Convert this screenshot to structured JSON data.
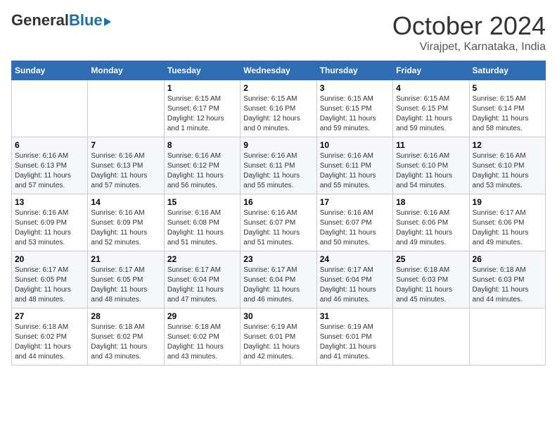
{
  "logo": {
    "general": "General",
    "blue": "Blue"
  },
  "title": "October 2024",
  "location": "Virajpet, Karnataka, India",
  "days_of_week": [
    "Sunday",
    "Monday",
    "Tuesday",
    "Wednesday",
    "Thursday",
    "Friday",
    "Saturday"
  ],
  "weeks": [
    [
      {
        "day": "",
        "info": ""
      },
      {
        "day": "",
        "info": ""
      },
      {
        "day": "1",
        "info": "Sunrise: 6:15 AM\nSunset: 6:17 PM\nDaylight: 12 hours\nand 1 minute."
      },
      {
        "day": "2",
        "info": "Sunrise: 6:15 AM\nSunset: 6:16 PM\nDaylight: 12 hours\nand 0 minutes."
      },
      {
        "day": "3",
        "info": "Sunrise: 6:15 AM\nSunset: 6:15 PM\nDaylight: 11 hours\nand 59 minutes."
      },
      {
        "day": "4",
        "info": "Sunrise: 6:15 AM\nSunset: 6:15 PM\nDaylight: 11 hours\nand 59 minutes."
      },
      {
        "day": "5",
        "info": "Sunrise: 6:15 AM\nSunset: 6:14 PM\nDaylight: 11 hours\nand 58 minutes."
      }
    ],
    [
      {
        "day": "6",
        "info": "Sunrise: 6:16 AM\nSunset: 6:13 PM\nDaylight: 11 hours\nand 57 minutes."
      },
      {
        "day": "7",
        "info": "Sunrise: 6:16 AM\nSunset: 6:13 PM\nDaylight: 11 hours\nand 57 minutes."
      },
      {
        "day": "8",
        "info": "Sunrise: 6:16 AM\nSunset: 6:12 PM\nDaylight: 11 hours\nand 56 minutes."
      },
      {
        "day": "9",
        "info": "Sunrise: 6:16 AM\nSunset: 6:11 PM\nDaylight: 11 hours\nand 55 minutes."
      },
      {
        "day": "10",
        "info": "Sunrise: 6:16 AM\nSunset: 6:11 PM\nDaylight: 11 hours\nand 55 minutes."
      },
      {
        "day": "11",
        "info": "Sunrise: 6:16 AM\nSunset: 6:10 PM\nDaylight: 11 hours\nand 54 minutes."
      },
      {
        "day": "12",
        "info": "Sunrise: 6:16 AM\nSunset: 6:10 PM\nDaylight: 11 hours\nand 53 minutes."
      }
    ],
    [
      {
        "day": "13",
        "info": "Sunrise: 6:16 AM\nSunset: 6:09 PM\nDaylight: 11 hours\nand 53 minutes."
      },
      {
        "day": "14",
        "info": "Sunrise: 6:16 AM\nSunset: 6:09 PM\nDaylight: 11 hours\nand 52 minutes."
      },
      {
        "day": "15",
        "info": "Sunrise: 6:16 AM\nSunset: 6:08 PM\nDaylight: 11 hours\nand 51 minutes."
      },
      {
        "day": "16",
        "info": "Sunrise: 6:16 AM\nSunset: 6:07 PM\nDaylight: 11 hours\nand 51 minutes."
      },
      {
        "day": "17",
        "info": "Sunrise: 6:16 AM\nSunset: 6:07 PM\nDaylight: 11 hours\nand 50 minutes."
      },
      {
        "day": "18",
        "info": "Sunrise: 6:16 AM\nSunset: 6:06 PM\nDaylight: 11 hours\nand 49 minutes."
      },
      {
        "day": "19",
        "info": "Sunrise: 6:17 AM\nSunset: 6:06 PM\nDaylight: 11 hours\nand 49 minutes."
      }
    ],
    [
      {
        "day": "20",
        "info": "Sunrise: 6:17 AM\nSunset: 6:05 PM\nDaylight: 11 hours\nand 48 minutes."
      },
      {
        "day": "21",
        "info": "Sunrise: 6:17 AM\nSunset: 6:05 PM\nDaylight: 11 hours\nand 48 minutes."
      },
      {
        "day": "22",
        "info": "Sunrise: 6:17 AM\nSunset: 6:04 PM\nDaylight: 11 hours\nand 47 minutes."
      },
      {
        "day": "23",
        "info": "Sunrise: 6:17 AM\nSunset: 6:04 PM\nDaylight: 11 hours\nand 46 minutes."
      },
      {
        "day": "24",
        "info": "Sunrise: 6:17 AM\nSunset: 6:04 PM\nDaylight: 11 hours\nand 46 minutes."
      },
      {
        "day": "25",
        "info": "Sunrise: 6:18 AM\nSunset: 6:03 PM\nDaylight: 11 hours\nand 45 minutes."
      },
      {
        "day": "26",
        "info": "Sunrise: 6:18 AM\nSunset: 6:03 PM\nDaylight: 11 hours\nand 44 minutes."
      }
    ],
    [
      {
        "day": "27",
        "info": "Sunrise: 6:18 AM\nSunset: 6:02 PM\nDaylight: 11 hours\nand 44 minutes."
      },
      {
        "day": "28",
        "info": "Sunrise: 6:18 AM\nSunset: 6:02 PM\nDaylight: 11 hours\nand 43 minutes."
      },
      {
        "day": "29",
        "info": "Sunrise: 6:18 AM\nSunset: 6:02 PM\nDaylight: 11 hours\nand 43 minutes."
      },
      {
        "day": "30",
        "info": "Sunrise: 6:19 AM\nSunset: 6:01 PM\nDaylight: 11 hours\nand 42 minutes."
      },
      {
        "day": "31",
        "info": "Sunrise: 6:19 AM\nSunset: 6:01 PM\nDaylight: 11 hours\nand 41 minutes."
      },
      {
        "day": "",
        "info": ""
      },
      {
        "day": "",
        "info": ""
      }
    ]
  ]
}
